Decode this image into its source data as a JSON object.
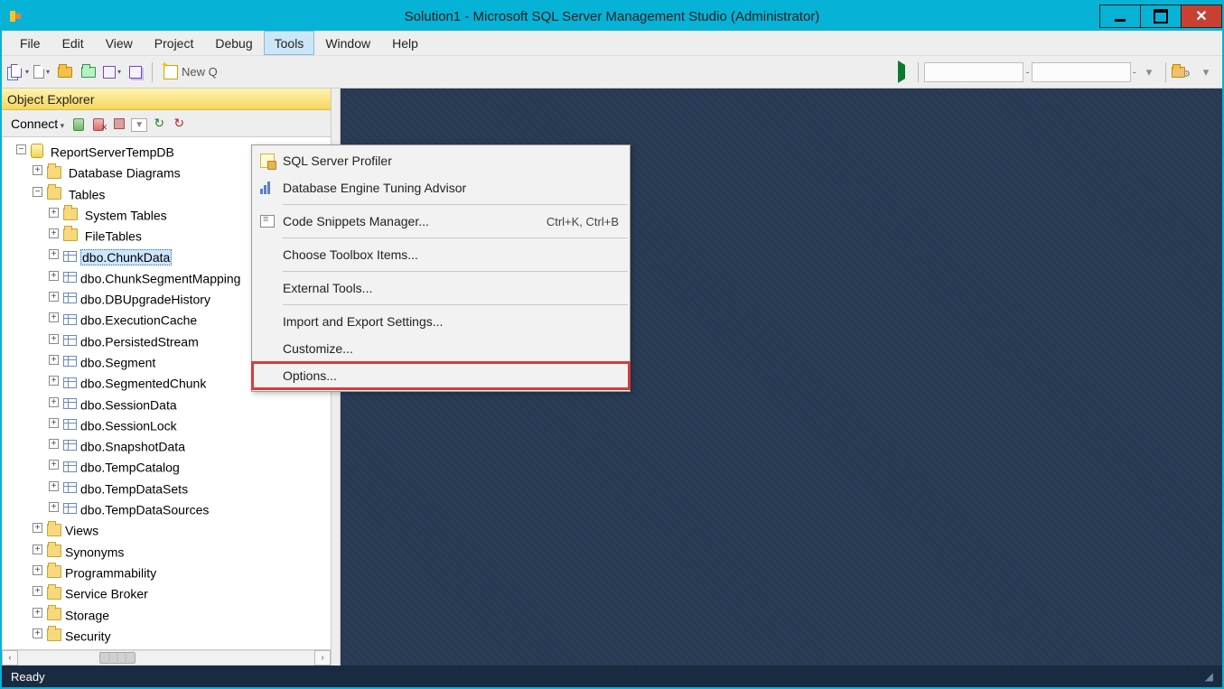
{
  "window": {
    "title": "Solution1 - Microsoft SQL Server Management Studio (Administrator)"
  },
  "menu": {
    "items": [
      "File",
      "Edit",
      "View",
      "Project",
      "Debug",
      "Tools",
      "Window",
      "Help"
    ],
    "active": "Tools"
  },
  "toolbar": {
    "new_query": "New Q"
  },
  "tools_menu": {
    "items": [
      {
        "label": "SQL Server Profiler",
        "icon": "profiler",
        "shortcut": ""
      },
      {
        "label": "Database Engine Tuning Advisor",
        "icon": "tuning",
        "shortcut": ""
      },
      {
        "sep": true
      },
      {
        "label": "Code Snippets Manager...",
        "icon": "snippet",
        "shortcut": "Ctrl+K, Ctrl+B"
      },
      {
        "sep": true
      },
      {
        "label": "Choose Toolbox Items...",
        "icon": "",
        "shortcut": ""
      },
      {
        "sep": true
      },
      {
        "label": "External Tools...",
        "icon": "",
        "shortcut": ""
      },
      {
        "sep": true
      },
      {
        "label": "Import and Export Settings...",
        "icon": "",
        "shortcut": ""
      },
      {
        "label": "Customize...",
        "icon": "",
        "shortcut": ""
      },
      {
        "label": "Options...",
        "icon": "",
        "shortcut": "",
        "highlighted": true
      }
    ]
  },
  "object_explorer": {
    "title": "Object Explorer",
    "connect": "Connect"
  },
  "tree": {
    "root": "ReportServerTempDB",
    "folders_top": [
      "Database Diagrams"
    ],
    "tables_label": "Tables",
    "system_tables": "System Tables",
    "file_tables": "FileTables",
    "tables": [
      "dbo.ChunkData",
      "dbo.ChunkSegmentMapping",
      "dbo.DBUpgradeHistory",
      "dbo.ExecutionCache",
      "dbo.PersistedStream",
      "dbo.Segment",
      "dbo.SegmentedChunk",
      "dbo.SessionData",
      "dbo.SessionLock",
      "dbo.SnapshotData",
      "dbo.TempCatalog",
      "dbo.TempDataSets",
      "dbo.TempDataSources"
    ],
    "folders_bottom": [
      "Views",
      "Synonyms",
      "Programmability",
      "Service Broker",
      "Storage",
      "Security"
    ],
    "selected_table": "dbo.ChunkData"
  },
  "status": {
    "text": "Ready"
  }
}
